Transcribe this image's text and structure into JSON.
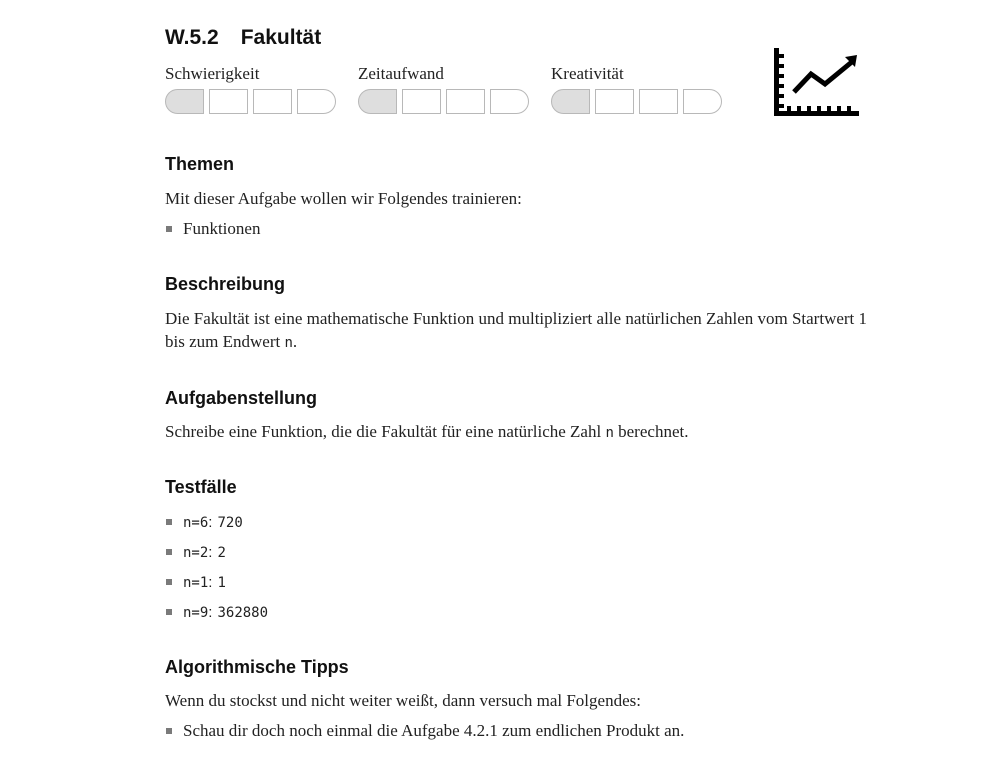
{
  "exercise": {
    "number": "W.5.2",
    "title": "Fakultät"
  },
  "ratings": [
    {
      "label": "Schwierigkeit",
      "level": 1,
      "max": 4
    },
    {
      "label": "Zeitaufwand",
      "level": 1,
      "max": 4
    },
    {
      "label": "Kreativität",
      "level": 1,
      "max": 4
    }
  ],
  "icon": "line-chart-icon",
  "sections": {
    "themen": {
      "heading": "Themen",
      "intro": "Mit dieser Aufgabe wollen wir Folgendes trainieren:",
      "items": [
        "Funktionen"
      ]
    },
    "beschreibung": {
      "heading": "Beschreibung",
      "text_before": "Die Fakultät ist eine mathematische Funktion und multipliziert alle natürlichen Zahlen vom Startwert 1 bis zum Endwert ",
      "code": "n",
      "text_after": "."
    },
    "aufgabenstellung": {
      "heading": "Aufgabenstellung",
      "text_before": "Schreibe eine Funktion, die die Fakultät für eine natürliche Zahl ",
      "code": "n",
      "text_after": " berechnet."
    },
    "testfaelle": {
      "heading": "Testfälle",
      "cases": [
        {
          "input": "n=6",
          "output": "720"
        },
        {
          "input": "n=2",
          "output": "2"
        },
        {
          "input": "n=1",
          "output": "1"
        },
        {
          "input": "n=9",
          "output": "362880"
        }
      ],
      "separator": ":"
    },
    "tipps": {
      "heading": "Algorithmische Tipps",
      "intro": "Wenn du stockst und nicht weiter weißt, dann versuch mal Folgendes:",
      "items": [
        "Schau dir doch noch einmal die Aufgabe 4.2.1 zum endlichen Produkt an."
      ]
    }
  },
  "colors": {
    "meter_filled": "#dedede",
    "meter_border": "#b8b8b8",
    "bullet": "#7a7a7a",
    "icon": "#000000"
  }
}
